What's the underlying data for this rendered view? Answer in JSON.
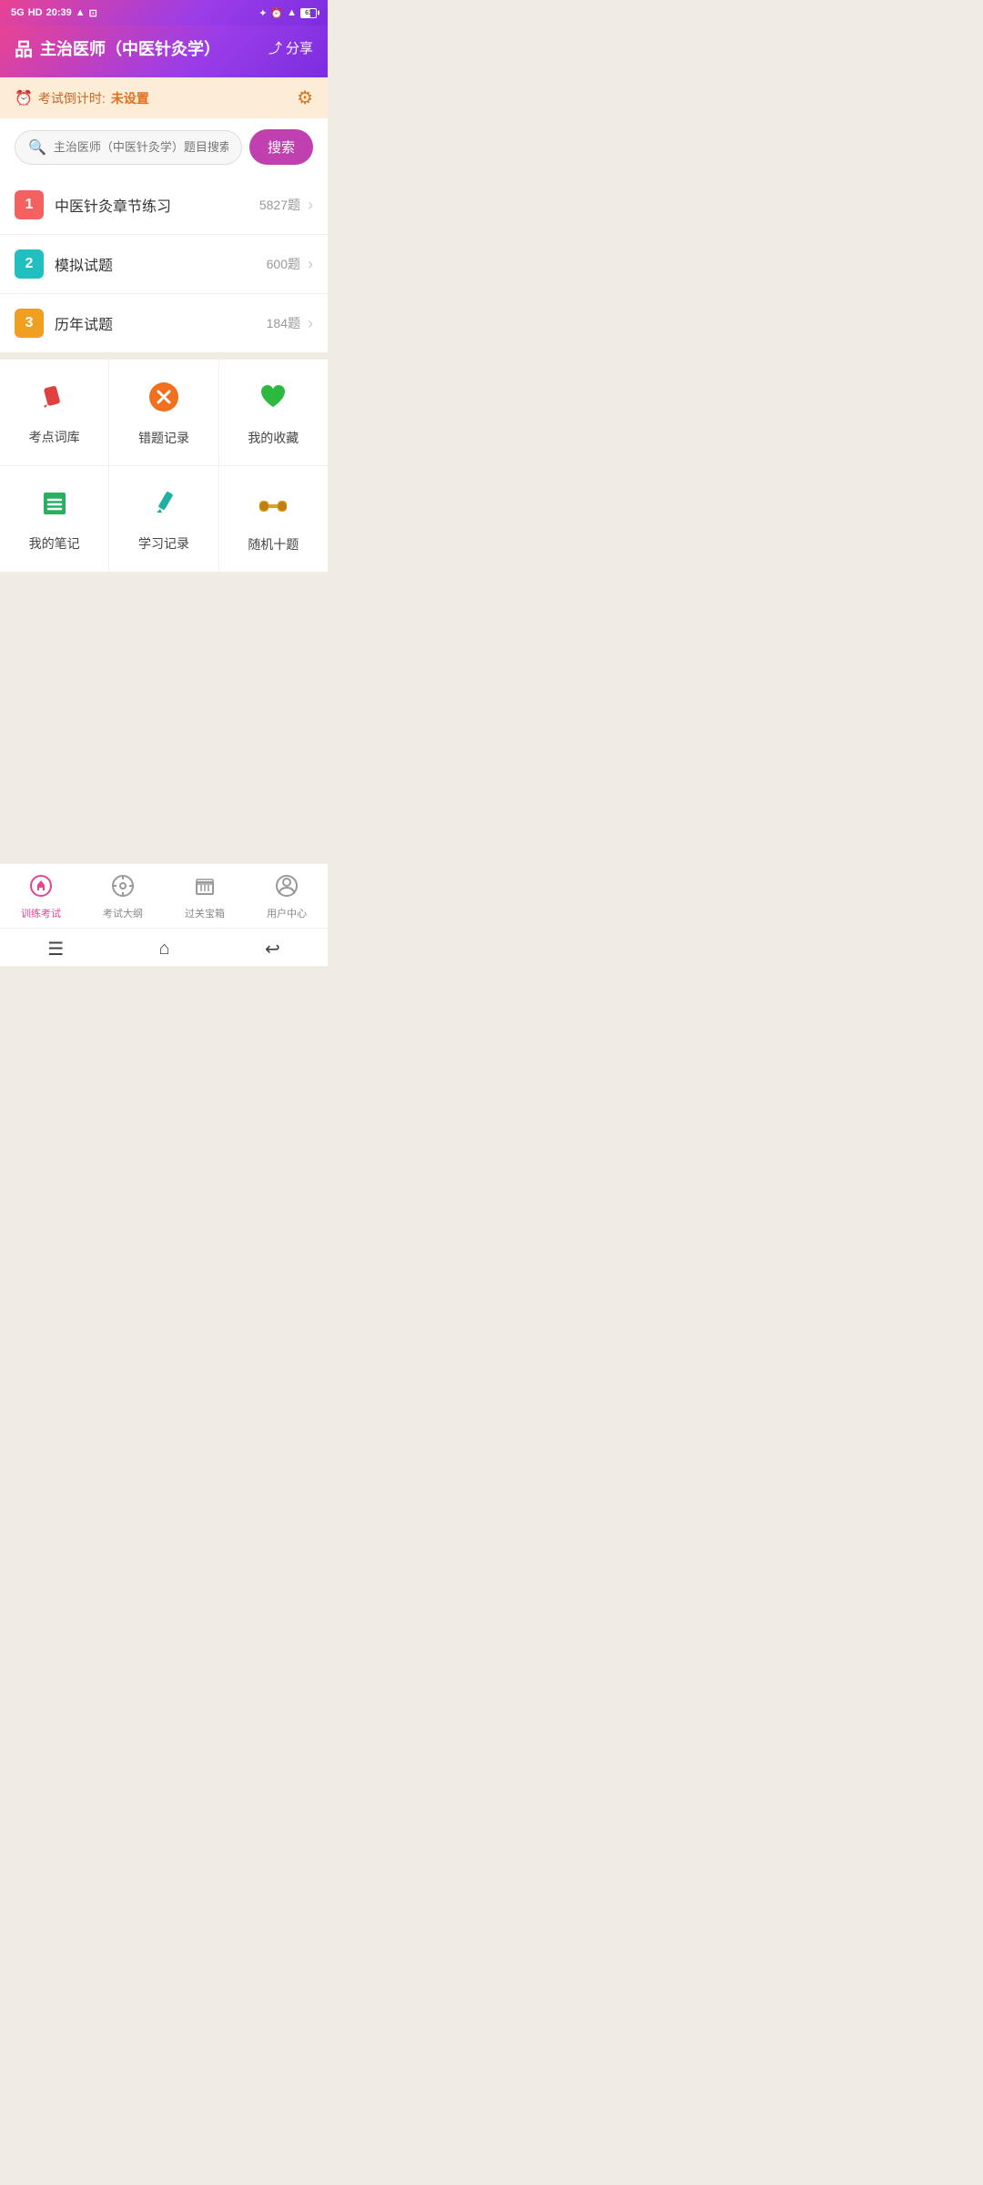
{
  "status_bar": {
    "network": "5G",
    "hd": "HD",
    "time": "20:39",
    "bluetooth_icon": "bluetooth-icon",
    "alarm_icon": "alarm-icon",
    "wifi_icon": "wifi-icon",
    "battery_label": "61"
  },
  "header": {
    "icon": "品",
    "title": "主治医师（中医针灸学）",
    "share_label": "分享"
  },
  "countdown": {
    "clock_icon": "clock-icon",
    "label": "考试倒计时:",
    "value": "未设置",
    "gear_icon": "gear-icon"
  },
  "search": {
    "placeholder": "主治医师（中医针灸学）题目搜索",
    "button_label": "搜索"
  },
  "list_items": [
    {
      "num": "1",
      "num_class": "num-1",
      "name": "中医针灸章节练习",
      "count": "5827题"
    },
    {
      "num": "2",
      "num_class": "num-2",
      "name": "模拟试题",
      "count": "600题"
    },
    {
      "num": "3",
      "num_class": "num-3",
      "name": "历年试题",
      "count": "184题"
    }
  ],
  "grid_items": [
    [
      {
        "key": "kaodian",
        "icon": "✏️",
        "icon_class": "icon-pencil",
        "label": "考点词库"
      },
      {
        "key": "cuoti",
        "icon": "✖",
        "icon_class": "icon-wrong",
        "label": "错题记录"
      },
      {
        "key": "shoucang",
        "icon": "♥",
        "icon_class": "icon-heart",
        "label": "我的收藏"
      }
    ],
    [
      {
        "key": "biji",
        "icon": "≡",
        "icon_class": "icon-notes",
        "label": "我的笔记"
      },
      {
        "key": "xuexi",
        "icon": "✒",
        "icon_class": "icon-pen",
        "label": "学习记录"
      },
      {
        "key": "suiji",
        "icon": "⊞",
        "icon_class": "icon-binoculars",
        "label": "随机十题"
      }
    ]
  ],
  "bottom_nav": [
    {
      "key": "train",
      "icon": "🏠",
      "label": "训练考试",
      "active": true
    },
    {
      "key": "outline",
      "icon": "⊕",
      "label": "考试大纲",
      "active": false
    },
    {
      "key": "treasure",
      "icon": "📖",
      "label": "过关宝箱",
      "active": false
    },
    {
      "key": "user",
      "icon": "👤",
      "label": "用户中心",
      "active": false
    }
  ],
  "sys_nav": {
    "menu_icon": "menu-icon",
    "home_icon": "home-icon",
    "back_icon": "back-icon"
  }
}
